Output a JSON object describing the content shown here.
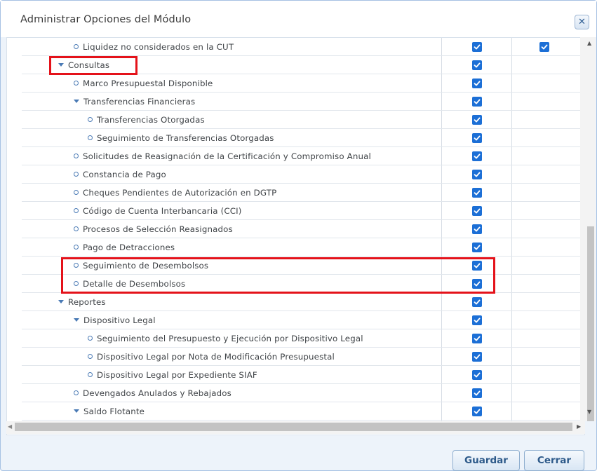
{
  "dialog": {
    "title": "Administrar Opciones del Módulo",
    "close_icon": "close-icon"
  },
  "tree": {
    "rows": [
      {
        "label": "Liquidez no considerados en la CUT",
        "type": "leaf",
        "level": 1,
        "check1": true,
        "check2": true
      },
      {
        "label": "Consultas",
        "type": "folder",
        "level": 0,
        "check1": true,
        "check2": false
      },
      {
        "label": "Marco Presupuestal Disponible",
        "type": "leaf",
        "level": 1,
        "check1": true,
        "check2": false
      },
      {
        "label": "Transferencias Financieras",
        "type": "folder",
        "level": 1,
        "check1": true,
        "check2": false
      },
      {
        "label": "Transferencias Otorgadas",
        "type": "leaf",
        "level": 2,
        "check1": true,
        "check2": false
      },
      {
        "label": "Seguimiento de Transferencias Otorgadas",
        "type": "leaf",
        "level": 2,
        "check1": true,
        "check2": false
      },
      {
        "label": "Solicitudes de Reasignación de la Certificación y Compromiso Anual",
        "type": "leaf",
        "level": 1,
        "check1": true,
        "check2": false
      },
      {
        "label": "Constancia de Pago",
        "type": "leaf",
        "level": 1,
        "check1": true,
        "check2": false
      },
      {
        "label": "Cheques Pendientes de Autorización en DGTP",
        "type": "leaf",
        "level": 1,
        "check1": true,
        "check2": false
      },
      {
        "label": "Código de Cuenta Interbancaria (CCI)",
        "type": "leaf",
        "level": 1,
        "check1": true,
        "check2": false
      },
      {
        "label": "Procesos de Selección Reasignados",
        "type": "leaf",
        "level": 1,
        "check1": true,
        "check2": false
      },
      {
        "label": "Pago de Detracciones",
        "type": "leaf",
        "level": 1,
        "check1": true,
        "check2": false
      },
      {
        "label": "Seguimiento de Desembolsos",
        "type": "leaf",
        "level": 1,
        "check1": true,
        "check2": false
      },
      {
        "label": "Detalle de Desembolsos",
        "type": "leaf",
        "level": 1,
        "check1": true,
        "check2": false
      },
      {
        "label": "Reportes",
        "type": "folder",
        "level": 0,
        "check1": true,
        "check2": false
      },
      {
        "label": "Dispositivo Legal",
        "type": "folder",
        "level": 1,
        "check1": true,
        "check2": false
      },
      {
        "label": "Seguimiento del Presupuesto y Ejecución por Dispositivo Legal",
        "type": "leaf",
        "level": 2,
        "check1": true,
        "check2": false
      },
      {
        "label": "Dispositivo Legal por Nota de Modificación Presupuestal",
        "type": "leaf",
        "level": 2,
        "check1": true,
        "check2": false
      },
      {
        "label": "Dispositivo Legal por Expediente SIAF",
        "type": "leaf",
        "level": 2,
        "check1": true,
        "check2": false
      },
      {
        "label": "Devengados Anulados y Rebajados",
        "type": "leaf",
        "level": 1,
        "check1": true,
        "check2": false
      },
      {
        "label": "Saldo Flotante",
        "type": "folder",
        "level": 1,
        "check1": true,
        "check2": false
      }
    ]
  },
  "footer": {
    "save_label": "Guardar",
    "close_label": "Cerrar"
  },
  "colors": {
    "checkbox": "#1c6fd6",
    "highlight": "#e4121a",
    "button_text": "#2d5a8a"
  }
}
